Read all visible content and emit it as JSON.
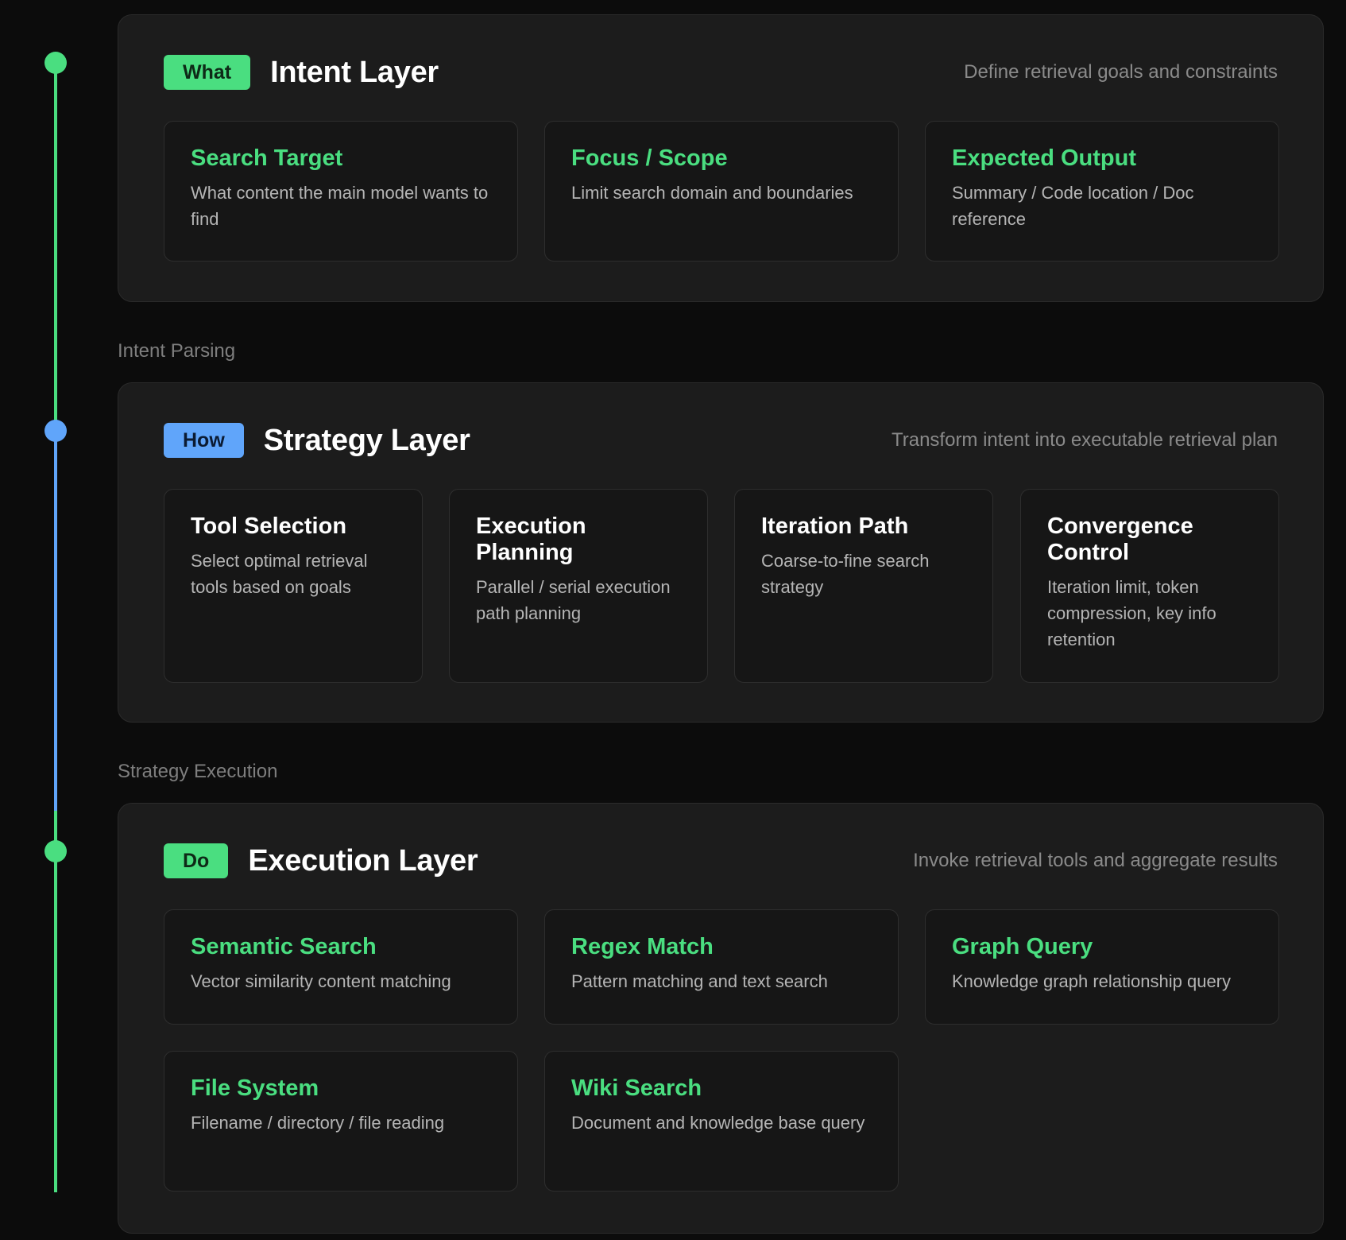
{
  "colors": {
    "background": "#0c0c0c",
    "panel": "#1c1c1c",
    "card": "#161616",
    "accent_green": "#4ade80",
    "accent_blue": "#60a5fa",
    "muted_text": "#8a8a8a"
  },
  "layers": [
    {
      "badge": "What",
      "title": "Intent Layer",
      "description": "Define retrieval goals and constraints",
      "cards": [
        {
          "title": "Search Target",
          "description": "What content the main model wants to find"
        },
        {
          "title": "Focus / Scope",
          "description": "Limit search domain and boundaries"
        },
        {
          "title": "Expected Output",
          "description": "Summary / Code location / Doc reference"
        }
      ]
    },
    {
      "badge": "How",
      "title": "Strategy Layer",
      "description": "Transform intent into executable retrieval plan",
      "cards": [
        {
          "title": "Tool Selection",
          "description": "Select optimal retrieval tools based on goals"
        },
        {
          "title": "Execution Planning",
          "description": "Parallel / serial execution path planning"
        },
        {
          "title": "Iteration Path",
          "description": "Coarse-to-fine search strategy"
        },
        {
          "title": "Convergence Control",
          "description": "Iteration limit, token compression, key info retention"
        }
      ]
    },
    {
      "badge": "Do",
      "title": "Execution Layer",
      "description": "Invoke retrieval tools and aggregate results",
      "cards": [
        {
          "title": "Semantic Search",
          "description": "Vector similarity content matching"
        },
        {
          "title": "Regex Match",
          "description": "Pattern matching and text search"
        },
        {
          "title": "Graph Query",
          "description": "Knowledge graph relationship query"
        },
        {
          "title": "File System",
          "description": "Filename / directory / file reading"
        },
        {
          "title": "Wiki Search",
          "description": "Document and knowledge base query"
        }
      ]
    }
  ],
  "connectors": [
    "Intent Parsing",
    "Strategy Execution"
  ]
}
